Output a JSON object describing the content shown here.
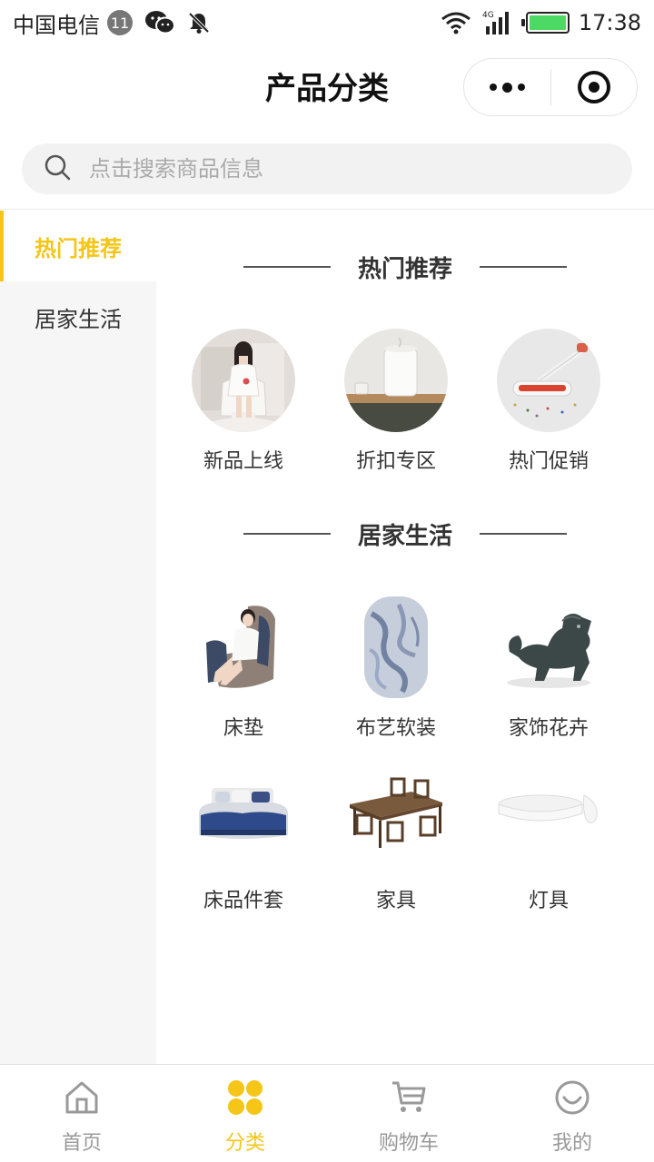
{
  "status_bar": {
    "carrier": "中国电信",
    "notification_count": "11",
    "time": "17:38",
    "network": "4G",
    "battery_level": 1.0
  },
  "header": {
    "title": "产品分类",
    "menu_icon": "more-dots-icon",
    "close_icon": "target-icon"
  },
  "search": {
    "placeholder": "点击搜索商品信息",
    "icon": "search-icon"
  },
  "sidebar": {
    "active_index": 0,
    "items": [
      {
        "label": "热门推荐"
      },
      {
        "label": "居家生活"
      }
    ]
  },
  "sections": [
    {
      "title": "热门推荐",
      "items": [
        {
          "label": "新品上线",
          "image": "woman-in-white-photo"
        },
        {
          "label": "折扣专区",
          "image": "humidifier-photo"
        },
        {
          "label": "热门促销",
          "image": "vacuum-cleaner-photo"
        }
      ]
    },
    {
      "title": "居家生活",
      "items": [
        {
          "label": "床垫",
          "image": "massage-chair-photo"
        },
        {
          "label": "布艺软装",
          "image": "rug-photo"
        },
        {
          "label": "家饰花卉",
          "image": "bronze-statue-photo"
        },
        {
          "label": "床品件套",
          "image": "bedding-photo"
        },
        {
          "label": "家具",
          "image": "dining-table-photo"
        },
        {
          "label": "灯具",
          "image": "ceiling-lamp-photo"
        }
      ]
    }
  ],
  "tab_bar": {
    "active_index": 1,
    "accent_color": "#f5c518",
    "tabs": [
      {
        "label": "首页",
        "icon": "home-icon"
      },
      {
        "label": "分类",
        "icon": "category-icon"
      },
      {
        "label": "购物车",
        "icon": "cart-icon"
      },
      {
        "label": "我的",
        "icon": "smile-icon"
      }
    ]
  }
}
